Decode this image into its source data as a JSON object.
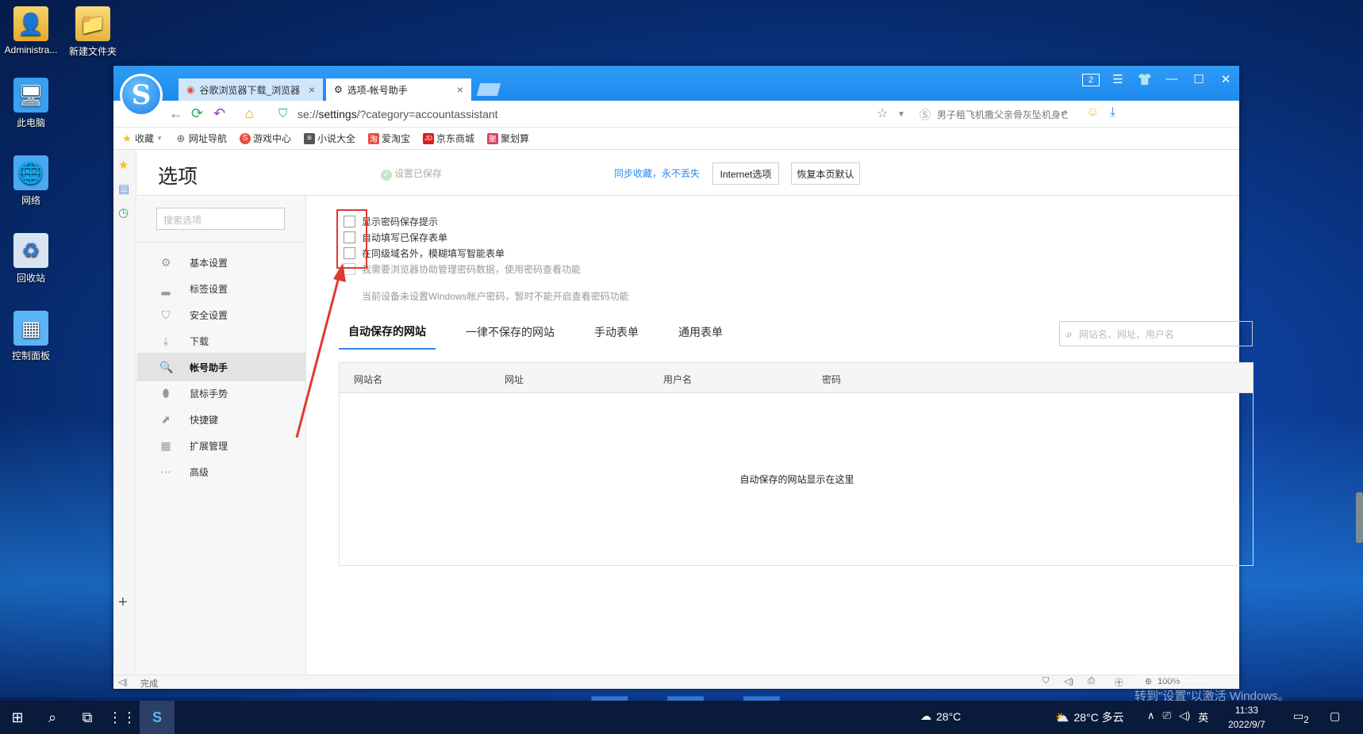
{
  "desktop": {
    "icons": [
      {
        "label": "Administra..."
      },
      {
        "label": "新建文件夹"
      },
      {
        "label": "此电脑"
      },
      {
        "label": "网络"
      },
      {
        "label": "回收站"
      },
      {
        "label": "控制面板"
      }
    ],
    "watermark_line1": "激活 Windows",
    "watermark_line2": "转到\"设置\"以激活 Windows。"
  },
  "browser": {
    "tabs": [
      {
        "label": "谷歌浏览器下载_浏览器",
        "close": "×"
      },
      {
        "label": "选项-帐号助手",
        "close": "×"
      }
    ],
    "window_badge": "2",
    "address": {
      "url_prefix": "se://",
      "url_path": "settings",
      "url_rest": "/?category=accountassistant",
      "search_text": "男子租飞机撒父亲骨灰坠机身亡"
    },
    "bookmarks": [
      {
        "label": "收藏",
        "icon": "star-icon"
      },
      {
        "label": "网址导航",
        "icon": "globe-icon"
      },
      {
        "label": "游戏中心",
        "icon": "game-icon"
      },
      {
        "label": "小说大全",
        "icon": "book-icon"
      },
      {
        "label": "爱淘宝",
        "icon": "taobao-icon"
      },
      {
        "label": "京东商城",
        "icon": "jd-icon"
      },
      {
        "label": "聚划算",
        "icon": "juhuasuan-icon"
      }
    ],
    "status_text": "完成",
    "zoom": "100%"
  },
  "settings": {
    "title": "选项",
    "saved_text": "设置已保存",
    "sync_link": "同步收藏，永不丢失",
    "internet_btn": "Internet选项",
    "restore_btn": "恢复本页默认",
    "search_placeholder": "搜索选项",
    "nav": [
      {
        "label": "基本设置",
        "icon": "gear-icon"
      },
      {
        "label": "标签设置",
        "icon": "tab-icon"
      },
      {
        "label": "安全设置",
        "icon": "shield-icon"
      },
      {
        "label": "下载",
        "icon": "download-icon"
      },
      {
        "label": "帐号助手",
        "icon": "key-icon"
      },
      {
        "label": "鼠标手势",
        "icon": "mouse-icon"
      },
      {
        "label": "快捷键",
        "icon": "shortcut-icon"
      },
      {
        "label": "扩展管理",
        "icon": "grid-icon"
      },
      {
        "label": "高级",
        "icon": "more-icon"
      }
    ],
    "active_nav": "帐号助手",
    "options": [
      {
        "label": "显示密码保存提示",
        "checked": false
      },
      {
        "label": "自动填写已保存表单",
        "checked": false
      },
      {
        "label": "在同级域名外，模糊填写智能表单",
        "checked": false
      },
      {
        "label": "我需要浏览器协助管理密码数据，使用密码查看功能",
        "checked": false,
        "disabled": true
      }
    ],
    "password_note": "当前设备未设置Windows帐户密码，暂时不能开启查看密码功能",
    "tabs": [
      {
        "label": "自动保存的网站"
      },
      {
        "label": "一律不保存的网站"
      },
      {
        "label": "手动表单"
      },
      {
        "label": "通用表单"
      }
    ],
    "table_search_placeholder": "网站名、网址、用户名",
    "table_headers": [
      "网站名",
      "网址",
      "用户名",
      "密码"
    ],
    "table_empty": "自动保存的网站显示在这里"
  },
  "taskbar": {
    "weather_left": "28°C",
    "weather_right": "28°C 多云",
    "ime": "英",
    "time": "11:33",
    "date": "2022/9/7",
    "notify_count": "2"
  },
  "colors": {
    "accent": "#2f86e6",
    "titlebar": "#1e8af0",
    "annotation": "#e03a2e"
  }
}
